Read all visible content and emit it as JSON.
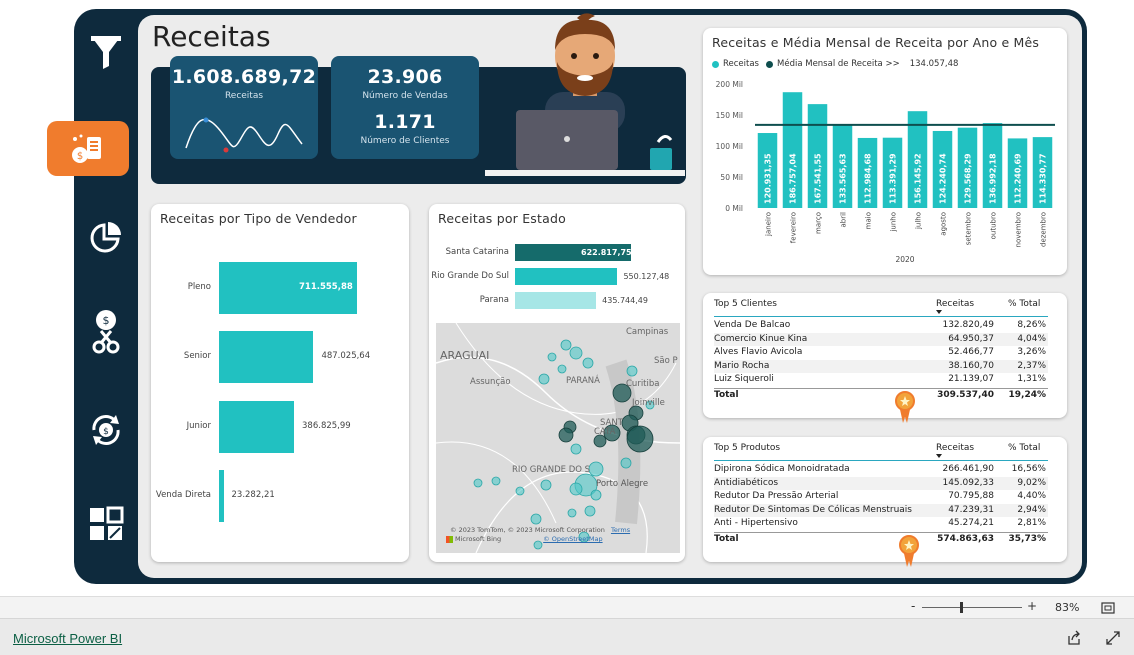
{
  "page": {
    "title": "Receitas"
  },
  "kpis": {
    "receitas_value": "1.608.689,72",
    "receitas_label": "Receitas",
    "vendas_value": "23.906",
    "vendas_label": "Número de Vendas",
    "clientes_value": "1.171",
    "clientes_label": "Número de Clientes"
  },
  "sidebar": {
    "icons": [
      "filter-icon",
      "sales-icon",
      "pie-chart-icon",
      "money-scissors-icon",
      "money-cycle-icon",
      "grid-apps-icon"
    ]
  },
  "monthly_chart": {
    "title": "Receitas e Média Mensal de Receita por Ano e Mês",
    "legend_receitas": "Receitas",
    "legend_media": "Média Mensal de Receita >>",
    "media_value": "134.057,48",
    "year": "2020",
    "y_ticks": [
      "200 Mil",
      "150 Mil",
      "100 Mil",
      "50 Mil",
      "0 Mil"
    ]
  },
  "chart_data": [
    {
      "type": "bar",
      "title": "Receitas e Média Mensal de Receita por Ano e Mês",
      "categories": [
        "janeiro",
        "fevereiro",
        "março",
        "abril",
        "maio",
        "junho",
        "julho",
        "agosto",
        "setembro",
        "outubro",
        "novembro",
        "dezembro"
      ],
      "series": [
        {
          "name": "Receitas",
          "values": [
            120931.35,
            186757.04,
            167541.55,
            133565.63,
            112984.68,
            113391.29,
            156145.92,
            124240.74,
            129568.29,
            136992.18,
            112240.69,
            114330.77
          ]
        }
      ],
      "labels": [
        "120.931,35",
        "186.757,04",
        "167.541,55",
        "133.565,63",
        "112.984,68",
        "113.391,29",
        "156.145,92",
        "124.240,74",
        "129.568,29",
        "136.992,18",
        "112.240,69",
        "114.330,77"
      ],
      "reference_line": {
        "name": "Média Mensal de Receita",
        "value": 134057.48
      },
      "ylim": [
        0,
        200000
      ],
      "colors": {
        "bar": "#21c1c1",
        "line": "#0e4e4e"
      }
    },
    {
      "type": "bar",
      "title": "Receitas por Tipo de Vendedor",
      "categories": [
        "Pleno",
        "Senior",
        "Junior",
        "Venda Direta"
      ],
      "values": [
        711555.88,
        487025.64,
        386825.99,
        23282.21
      ],
      "labels": [
        "711.555,88",
        "487.025,64",
        "386.825,99",
        "23.282,21"
      ]
    },
    {
      "type": "bar",
      "title": "Receitas por Estado",
      "categories": [
        "Santa Catarina",
        "Rio Grande Do Sul",
        "Parana"
      ],
      "values": [
        622817.75,
        550127.48,
        435744.49
      ],
      "labels": [
        "622.817,75",
        "550.127,48",
        "435.744,49"
      ],
      "colors": [
        "#156b6b",
        "#21c1c1",
        "#a6e6e6"
      ]
    }
  ],
  "vendedor_chart": {
    "title": "Receitas por Tipo de Vendedor"
  },
  "estado_chart": {
    "title": "Receitas por Estado"
  },
  "map": {
    "labels": [
      "Campinas",
      "ARAGUAI",
      "São P",
      "PARANÁ",
      "Assunção",
      "Curitiba",
      "Joinville",
      "SANT",
      "CATA",
      "RIO GRANDE DO S",
      "Porto Alegre"
    ],
    "copyright": "© 2023 TomTom, © 2023 Microsoft Corporation",
    "terms": "Terms",
    "osm": "© OpenStreetMap",
    "bing": "Microsoft Bing"
  },
  "top_clientes": {
    "title": "Top 5 Clientes",
    "col_receitas": "Receitas",
    "col_total": "% Total",
    "rows": [
      {
        "name": "Venda De Balcao",
        "value": "132.820,49",
        "pct": "8,26%"
      },
      {
        "name": "Comercio Kinue Kina",
        "value": "64.950,37",
        "pct": "4,04%"
      },
      {
        "name": "Alves Flavio Avicola",
        "value": "52.466,77",
        "pct": "3,26%"
      },
      {
        "name": "Mario Rocha",
        "value": "38.160,70",
        "pct": "2,37%"
      },
      {
        "name": "Luiz Siqueroli",
        "value": "21.139,07",
        "pct": "1,31%"
      }
    ],
    "total_label": "Total",
    "total_value": "309.537,40",
    "total_pct": "19,24%"
  },
  "top_produtos": {
    "title": "Top 5 Produtos",
    "col_receitas": "Receitas",
    "col_total": "% Total",
    "rows": [
      {
        "name": "Dipirona Sódica Monoidratada",
        "value": "266.461,90",
        "pct": "16,56%"
      },
      {
        "name": "Antidiabéticos",
        "value": "145.092,33",
        "pct": "9,02%"
      },
      {
        "name": "Redutor Da Pressão Arterial",
        "value": "70.795,88",
        "pct": "4,40%"
      },
      {
        "name": "Redutor De Sintomas De Cólicas Menstruais",
        "value": "47.239,31",
        "pct": "2,94%"
      },
      {
        "name": "Anti - Hipertensivo",
        "value": "45.274,21",
        "pct": "2,81%"
      }
    ],
    "total_label": "Total",
    "total_value": "574.863,63",
    "total_pct": "35,73%"
  },
  "zoom": {
    "minus": "-",
    "plus": "+",
    "level": "83%",
    "value": 83
  },
  "footer": {
    "brand": "Microsoft Power BI"
  }
}
